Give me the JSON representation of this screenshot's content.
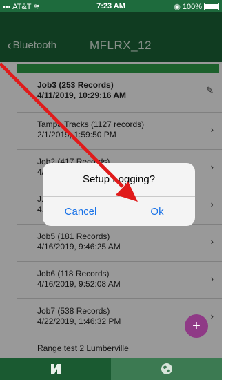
{
  "status_bar": {
    "carrier": "AT&T",
    "time": "7:23 AM",
    "battery": "100%"
  },
  "nav": {
    "back_label": "Bluetooth",
    "title": "MFLRX_12"
  },
  "jobs": [
    {
      "name": "Job3 (253 Records)",
      "date": "4/11/2019, 10:29:16 AM",
      "icon": "pencil-icon"
    },
    {
      "name": "Tampa Tracks (1127 records)",
      "date": "2/1/2019, 1:59:50 PM",
      "icon": "chevron-right-icon"
    },
    {
      "name": "Job2 (417 Records)",
      "date": "4/...",
      "icon": "chevron-right-icon"
    },
    {
      "name": "J...",
      "date": "4...",
      "icon": "chevron-right-icon"
    },
    {
      "name": "Job5 (181 Records)",
      "date": "4/16/2019, 9:46:25 AM",
      "icon": "chevron-right-icon"
    },
    {
      "name": "Job6 (118 Records)",
      "date": "4/16/2019, 9:52:08 AM",
      "icon": "chevron-right-icon"
    },
    {
      "name": "Job7 (538 Records)",
      "date": "4/22/2019, 1:46:32 PM",
      "icon": "chevron-right-icon"
    },
    {
      "name": "Range test 2 Lumberville",
      "date": "",
      "icon": "chevron-right-icon"
    }
  ],
  "alert": {
    "title": "Setup Logging?",
    "cancel_label": "Cancel",
    "ok_label": "Ok"
  },
  "fab_label": "+",
  "tabs": [
    {
      "icon": "n-logo-icon"
    },
    {
      "icon": "globe-icon"
    }
  ],
  "colors": {
    "nav_green": "#1b6236",
    "accent_green": "#2e9b47",
    "fab_purple": "#8f3a86",
    "link_blue": "#1a73e8",
    "annotation_red": "#e01b1b"
  }
}
